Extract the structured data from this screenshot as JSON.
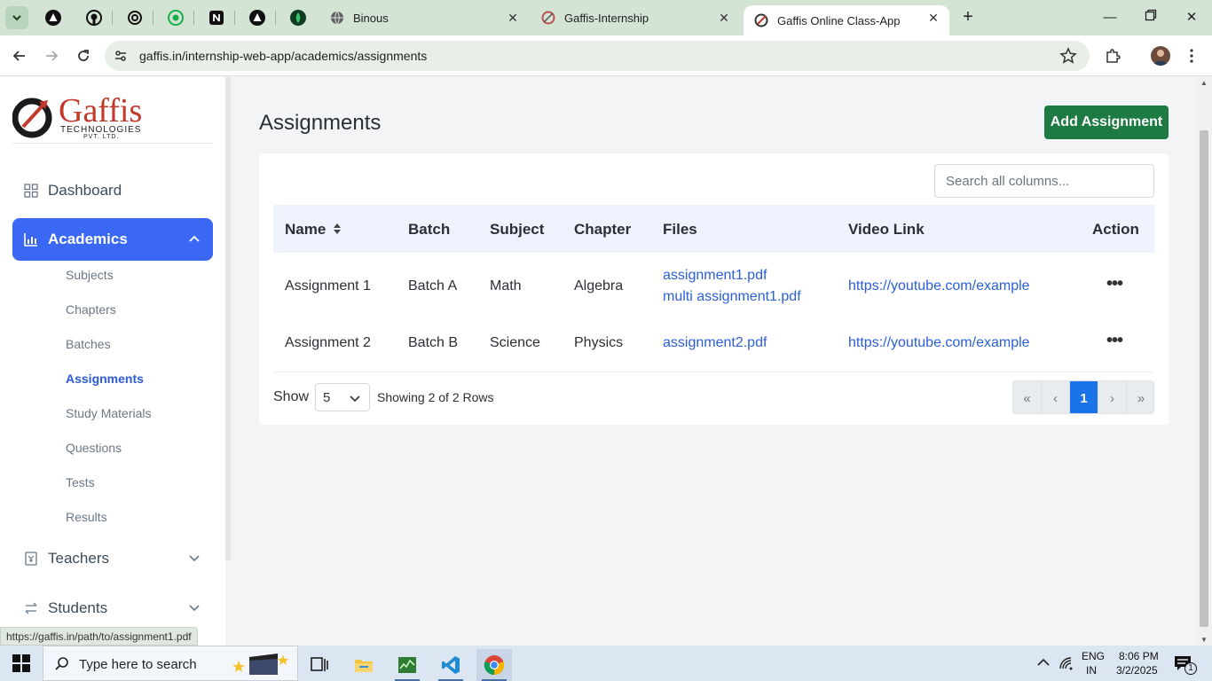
{
  "browser": {
    "tabs": [
      {
        "label": "Binous"
      },
      {
        "label": "Gaffis-Internship"
      },
      {
        "label": "Gaffis Online Class-App"
      }
    ],
    "url": "gaffis.in/internship-web-app/academics/assignments",
    "status_url": "https://gaffis.in/path/to/assignment1.pdf"
  },
  "sidebar": {
    "logo_title": "Gaffis",
    "logo_sub1": "TECHNOLOGIES",
    "logo_sub2": "PVT. LTD.",
    "dashboard": "Dashboard",
    "academics": "Academics",
    "sub_items": [
      "Subjects",
      "Chapters",
      "Batches",
      "Assignments",
      "Study Materials",
      "Questions",
      "Tests",
      "Results"
    ],
    "teachers": "Teachers",
    "students": "Students"
  },
  "main": {
    "title": "Assignments",
    "add_button": "Add Assignment",
    "search_placeholder": "Search all columns..."
  },
  "table": {
    "headers": [
      "Name",
      "Batch",
      "Subject",
      "Chapter",
      "Files",
      "Video Link",
      "Action"
    ],
    "rows": [
      {
        "name": "Assignment 1",
        "batch": "Batch A",
        "subject": "Math",
        "chapter": "Algebra",
        "files": [
          "assignment1.pdf",
          "multi assignment1.pdf"
        ],
        "video": "https://youtube.com/example",
        "action": "•••"
      },
      {
        "name": "Assignment 2",
        "batch": "Batch B",
        "subject": "Science",
        "chapter": "Physics",
        "files": [
          "assignment2.pdf"
        ],
        "video": "https://youtube.com/example",
        "action": "•••"
      }
    ]
  },
  "pagination": {
    "show_label": "Show",
    "page_size": "5",
    "showing_text": "Showing 2 of 2 Rows",
    "first": "«",
    "prev": "‹",
    "current": "1",
    "next": "›",
    "last": "»"
  },
  "taskbar": {
    "search_placeholder": "Type here to search",
    "lang1": "ENG",
    "lang2": "IN",
    "time": "8:06 PM",
    "date": "3/2/2025",
    "notification_count": "1"
  },
  "colors": {
    "accent": "#3a68f5",
    "add_button": "#1d7a42",
    "link": "#2a5fd8",
    "table_header_bg": "#eef2fd"
  }
}
